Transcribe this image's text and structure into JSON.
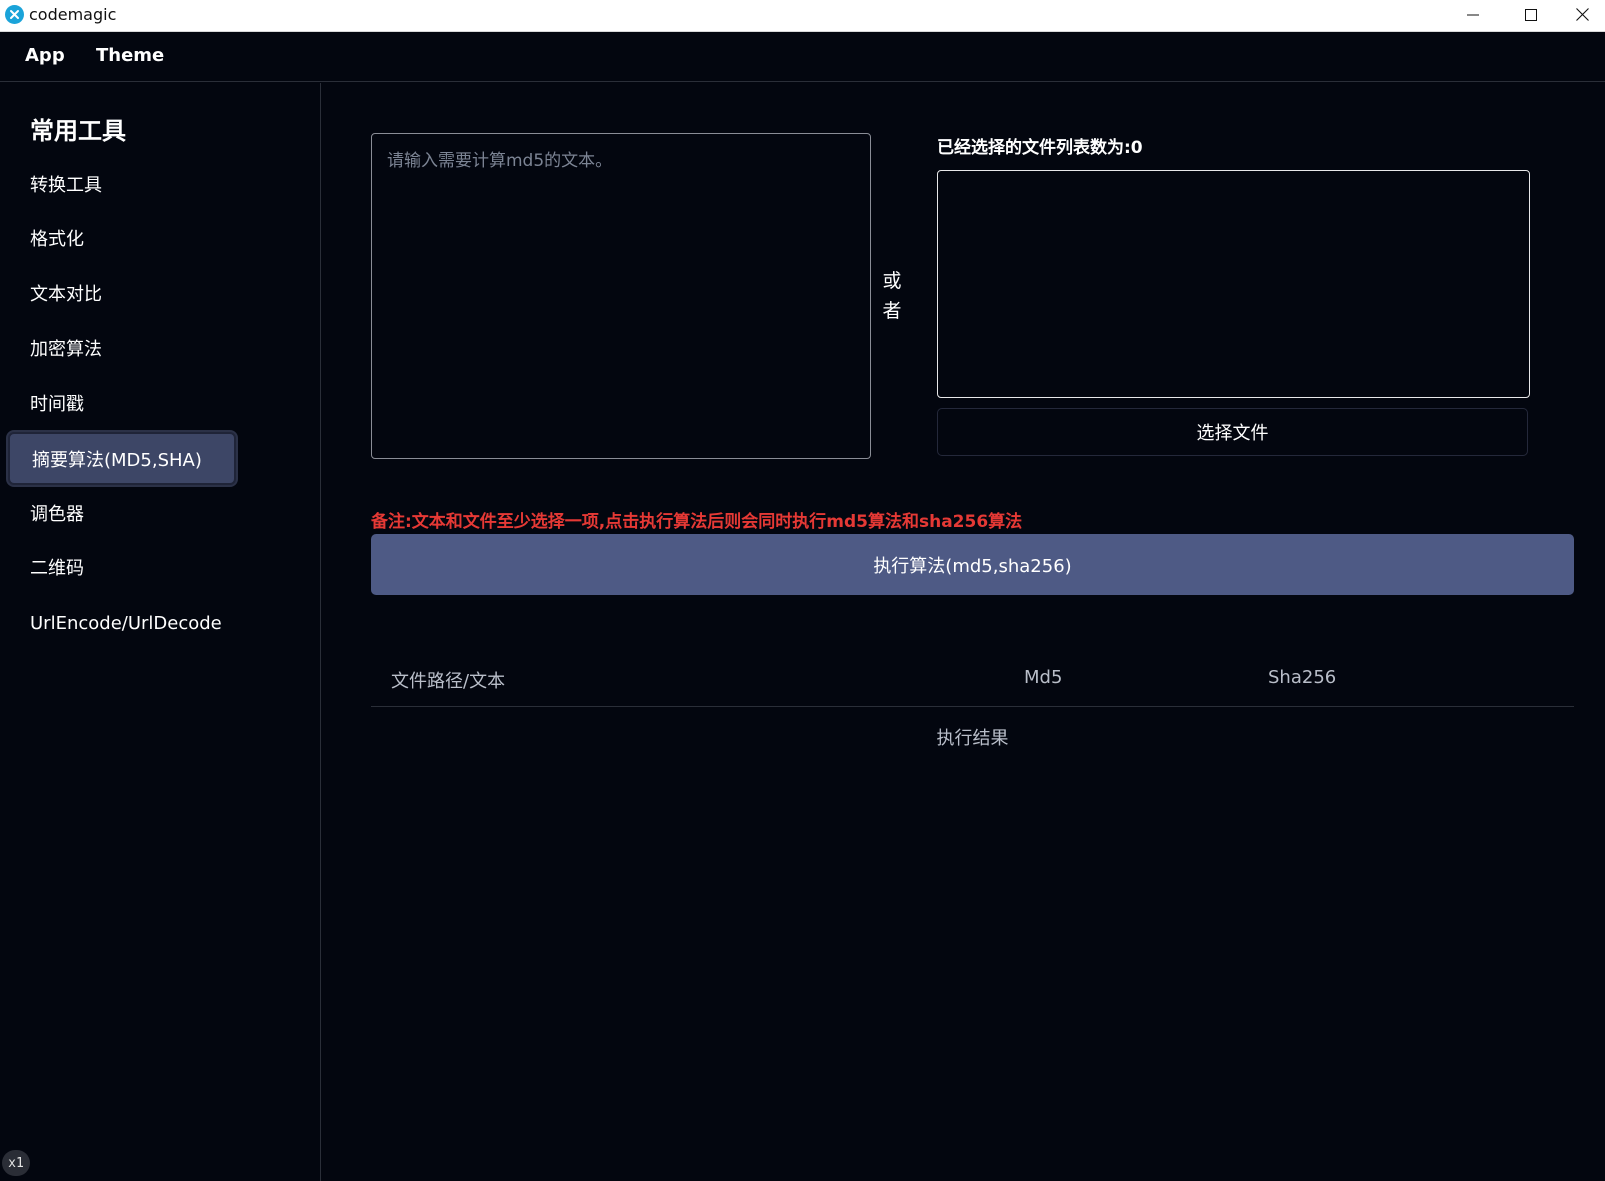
{
  "window": {
    "title": "codemagic",
    "app_icon": "codemagic-logo-icon",
    "controls": [
      "minimize-icon",
      "maximize-icon",
      "close-icon"
    ]
  },
  "menubar": {
    "items": [
      {
        "label": "App"
      },
      {
        "label": "Theme"
      }
    ]
  },
  "sidebar": {
    "heading": "常用工具",
    "items": [
      {
        "label": "转换工具"
      },
      {
        "label": "格式化"
      },
      {
        "label": "文本对比"
      },
      {
        "label": "加密算法"
      },
      {
        "label": "时间戳"
      },
      {
        "label": "摘要算法(MD5,SHA)",
        "active": true
      },
      {
        "label": "调色器"
      },
      {
        "label": "二维码"
      },
      {
        "label": "UrlEncode/UrlDecode"
      }
    ],
    "zoom_badge": "x1"
  },
  "main": {
    "text_input": {
      "placeholder": "请输入需要计算md5的文本。",
      "value": ""
    },
    "or_label_1": "或",
    "or_label_2": "者",
    "file_list_title": "已经选择的文件列表数为:0",
    "choose_file_button": "选择文件",
    "note": "备注:文本和文件至少选择一项,点击执行算法后则会同时执行md5算法和sha256算法",
    "run_button": "执行算法(md5,sha256)",
    "results": {
      "columns": [
        "文件路径/文本",
        "Md5",
        "Sha256"
      ],
      "empty_text": "执行结果"
    }
  },
  "colors": {
    "background": "#03060f",
    "active_item": "#3d4666",
    "run_button": "#4e5a85",
    "note": "#e53935"
  }
}
